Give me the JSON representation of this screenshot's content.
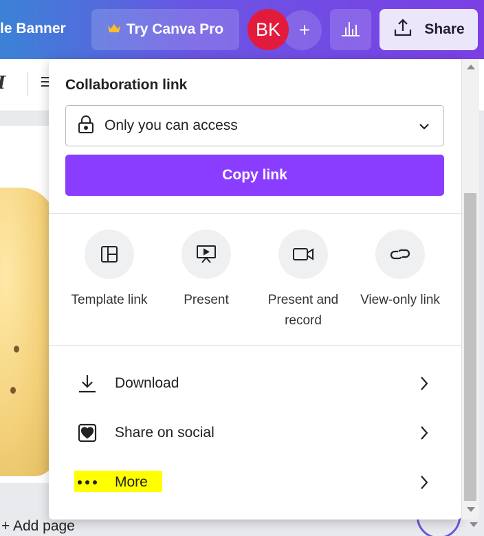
{
  "topbar": {
    "doc_title": "le Banner",
    "pro_label": "Try Canva Pro",
    "avatar_initials": "BK",
    "plus_label": "+",
    "share_label": "Share"
  },
  "editor": {
    "add_page_label": "+ Add page"
  },
  "share_panel": {
    "collab_label": "Collaboration link",
    "access_value": "Only you can access",
    "copy_link_label": "Copy link",
    "options": [
      {
        "label": "Template link",
        "icon": "template-icon"
      },
      {
        "label": "Present",
        "icon": "present-icon"
      },
      {
        "label": "Present and record",
        "icon": "video-camera-icon"
      },
      {
        "label": "View-only link",
        "icon": "link-icon"
      }
    ],
    "rows": [
      {
        "label": "Download",
        "icon": "download-icon"
      },
      {
        "label": "Share on social",
        "icon": "heart-icon"
      },
      {
        "label": "More",
        "icon": "more-dots-icon",
        "highlighted": true
      }
    ]
  },
  "colors": {
    "accent": "#8b3dff",
    "avatar": "#e21b3c",
    "highlight": "#ffff00"
  }
}
